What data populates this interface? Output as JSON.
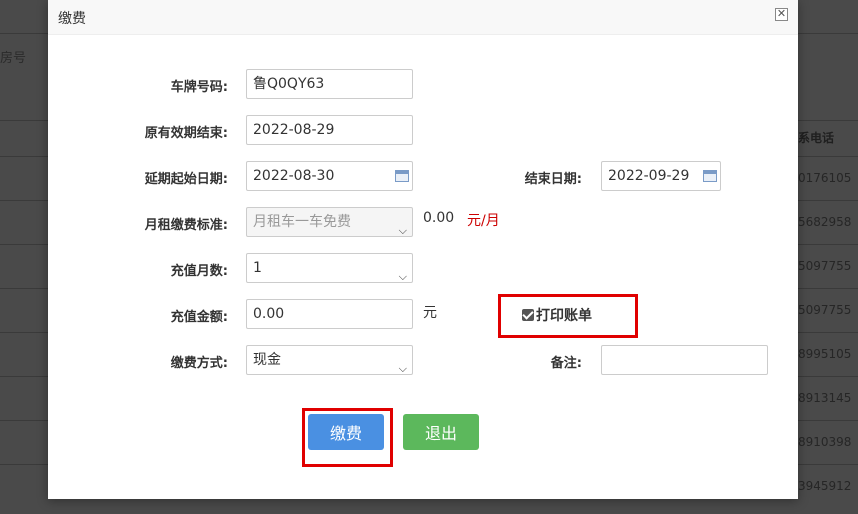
{
  "background": {
    "header_label": "房号",
    "col_header": "系电话",
    "cells": [
      "0176105",
      "5682958",
      "5097755",
      "5097755",
      "8995105",
      "8913145",
      "8910398",
      "3945912"
    ]
  },
  "dialog": {
    "title": "缴费",
    "close_glyph": "✕",
    "labels": {
      "plate": "车牌号码:",
      "orig_end": "原有效期结束:",
      "ext_start": "延期起始日期:",
      "end_date": "结束日期:",
      "monthly_std": "月租缴费标准:",
      "months": "充值月数:",
      "amount": "充值金额:",
      "pay_method": "缴费方式:",
      "remark": "备注:"
    },
    "values": {
      "plate": "鲁Q0QY63",
      "orig_end": "2022-08-29",
      "ext_start": "2022-08-30",
      "end_date": "2022-09-29",
      "monthly_std": "月租车一车免费",
      "monthly_fee": "0.00",
      "monthly_unit": "元/月",
      "months": "1",
      "amount": "0.00",
      "amount_unit": "元",
      "pay_method": "现金",
      "remark": ""
    },
    "print_receipt": {
      "label": "打印账单",
      "checked": true
    },
    "buttons": {
      "pay": "缴费",
      "exit": "退出"
    }
  },
  "colors": {
    "primary": "#4a90e2",
    "success": "#5cb85c",
    "highlight": "#e00000",
    "unit_red": "#cc0000"
  }
}
